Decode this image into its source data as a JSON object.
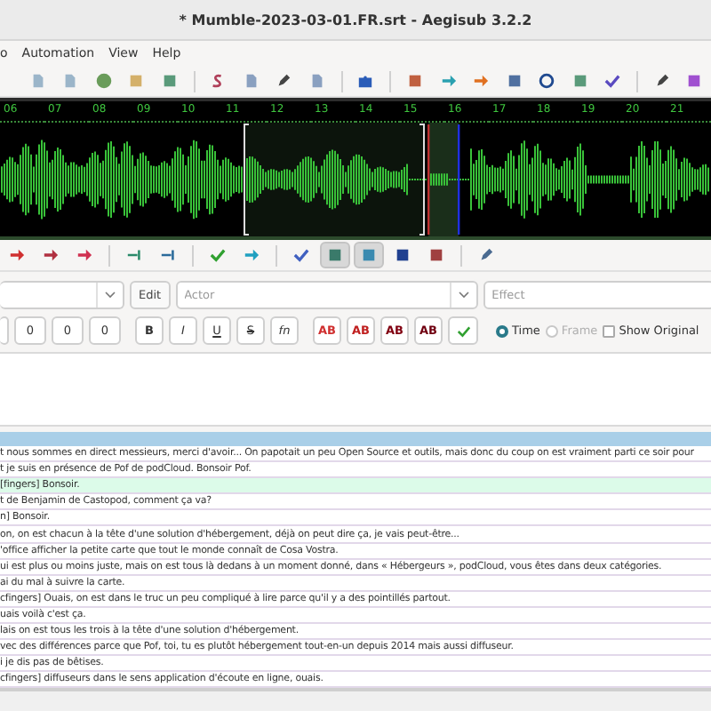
{
  "window": {
    "title": "* Mumble-2023-03-01.FR.srt - Aegisub 3.2.2"
  },
  "menu": [
    "o",
    "Automation",
    "View",
    "Help"
  ],
  "timeline": [
    "06",
    "07",
    "08",
    "09",
    "10",
    "11",
    "12",
    "13",
    "14",
    "15",
    "16",
    "17",
    "18",
    "19",
    "20",
    "21"
  ],
  "audio_toolbar": [
    {
      "selected": false
    },
    {
      "selected": false
    },
    {
      "selected": false
    },
    {
      "selected": false
    },
    {
      "selected": false
    },
    {
      "selected": false
    },
    {
      "selected": false
    },
    {
      "selected": false
    },
    {
      "selected": true
    },
    {
      "selected": true
    },
    {
      "selected": false
    },
    {
      "selected": false
    },
    {
      "selected": false
    }
  ],
  "editor": {
    "edit_button": "Edit",
    "actor": {
      "placeholder": "Actor"
    },
    "effect": {
      "placeholder": "Effect"
    },
    "margins": [
      "0",
      "0",
      "0"
    ],
    "format_buttons": [
      "B",
      "I",
      "U",
      "S",
      "fn"
    ],
    "color_buttons": [
      "AB",
      "AB",
      "AB",
      "AB"
    ],
    "time_modes": [
      {
        "label": "Time",
        "selected": true,
        "disabled": false
      },
      {
        "label": "Frame",
        "selected": false,
        "disabled": true
      }
    ],
    "show_original": {
      "label": "Show Original",
      "checked": false
    }
  },
  "grid": {
    "rows": [
      {
        "text": "t nous sommes en direct messieurs, merci d'avoir... On papotait un peu Open Source et outils, mais donc du coup on est vraiment parti ce soir pour",
        "selected": false
      },
      {
        "text": "t je suis en présence de Pof de podCloud. Bonsoir Pof.",
        "selected": false
      },
      {
        "text": "[fingers] Bonsoir.",
        "selected": true
      },
      {
        "text": "t de Benjamin de Castopod, comment ça va?",
        "selected": false
      },
      {
        "text": "n] Bonsoir.",
        "selected": false
      },
      {
        "text": "on, on est chacun à la tête d'une solution d'hébergement, déjà on peut dire ça, je vais peut-être...",
        "selected": false
      },
      {
        "text": "'office afficher la petite carte que tout le monde connaît de Cosa Vostra.",
        "selected": false
      },
      {
        "text": "ui est plus ou moins juste, mais on est tous là dedans à un moment donné, dans « Hébergeurs », podCloud, vous êtes dans deux catégories.",
        "selected": false
      },
      {
        "text": "ai du mal à suivre la carte.",
        "selected": false
      },
      {
        "text": "cfingers] Ouais, on est dans le truc un peu compliqué à lire parce qu'il y a des pointillés partout.",
        "selected": false
      },
      {
        "text": "uais voilà c'est ça.",
        "selected": false
      },
      {
        "text": "lais on est tous les trois à la tête d'une solution d'hébergement.",
        "selected": false
      },
      {
        "text": "vec des différences parce que Pof, toi, tu es plutôt hébergement tout-en-un depuis 2014 mais aussi diffuseur.",
        "selected": false
      },
      {
        "text": "i je dis pas de bêtises.",
        "selected": false
      },
      {
        "text": "cfingers] diffuseurs dans le sens application d'écoute en ligne, ouais.",
        "selected": false
      }
    ]
  }
}
